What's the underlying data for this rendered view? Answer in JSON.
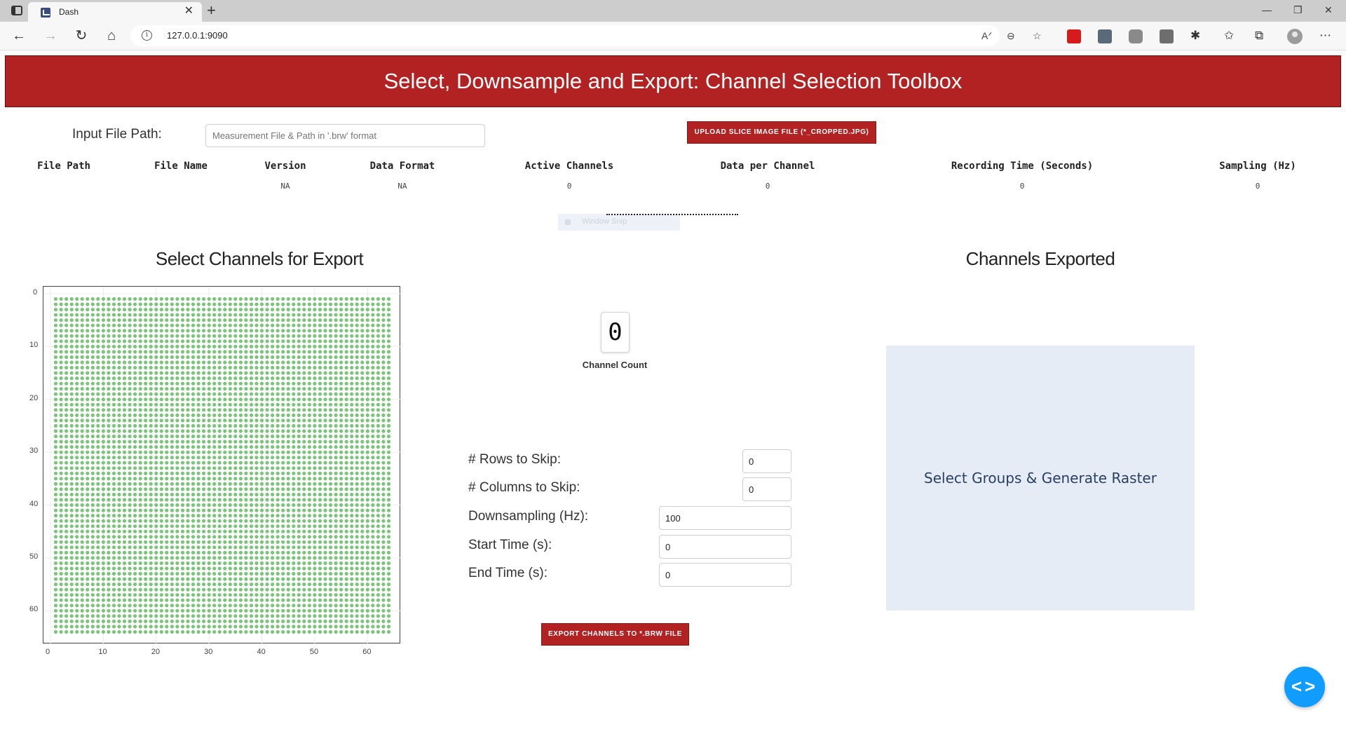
{
  "browser": {
    "tab_title": "Dash",
    "url": "127.0.0.1:9090"
  },
  "app": {
    "title": "Select, Downsample and Export: Channel Selection Toolbox",
    "input_label": "Input File Path:",
    "input_placeholder": "Measurement File & Path in '.brw' format",
    "upload_button": "UPLOAD SLICE IMAGE FILE (*_CROPPED.JPG)",
    "info_columns": [
      {
        "header": "File Path",
        "value": ""
      },
      {
        "header": "File Name",
        "value": ""
      },
      {
        "header": "Version",
        "value": "NA"
      },
      {
        "header": "Data Format",
        "value": "NA"
      },
      {
        "header": "Active Channels",
        "value": "0"
      },
      {
        "header": "Data per Channel",
        "value": "0"
      },
      {
        "header": "Recording Time (Seconds)",
        "value": "0"
      },
      {
        "header": "Sampling (Hz)",
        "value": "0"
      }
    ],
    "ghost_snip_label": "Window Snip",
    "select_title": "Select Channels for Export",
    "exported_title": "Channels Exported",
    "channel_count": {
      "value": "0",
      "label": "Channel Count"
    },
    "params": [
      {
        "label": "# Rows to Skip:",
        "value": "0"
      },
      {
        "label": "# Columns to Skip:",
        "value": "0"
      },
      {
        "label": "Downsampling (Hz):",
        "value": "100"
      },
      {
        "label": "Start Time (s):",
        "value": "0"
      },
      {
        "label": "End Time (s):",
        "value": "0"
      }
    ],
    "export_button": "EXPORT CHANNELS TO *.BRW FILE",
    "raster_placeholder": "Select Groups & Generate Raster",
    "colors": {
      "header_red": "#b22222",
      "marker_green": "#7cc47c",
      "raster_bg": "#e5ecf6",
      "fab_blue": "#119dff"
    }
  },
  "chart_data": {
    "type": "scatter",
    "description_grid": "64 x 64 electrode channel grid",
    "x": {
      "min": 1,
      "max": 64
    },
    "y": {
      "min": 1,
      "max": 64
    },
    "marker_color": "#7cc47c",
    "xlim": [
      0,
      65
    ],
    "ylim": [
      0,
      65
    ],
    "y_reversed": true,
    "x_ticks": [
      "0",
      "10",
      "20",
      "30",
      "40",
      "50",
      "60"
    ],
    "y_ticks": [
      "0",
      "10",
      "20",
      "30",
      "40",
      "50",
      "60"
    ]
  }
}
